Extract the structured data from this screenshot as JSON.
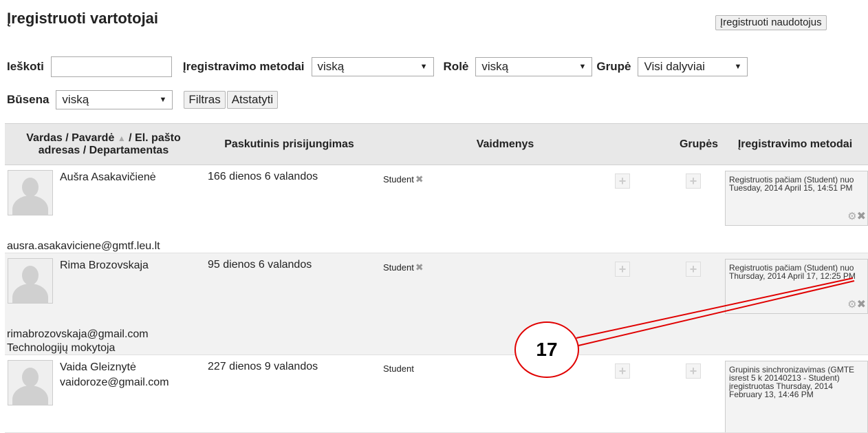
{
  "header": {
    "title": "Įregistruoti vartotojai",
    "enrol_button": "Įregistruoti naudotojus"
  },
  "filters": {
    "search_label": "Ieškoti",
    "search_value": "",
    "method_label": "Įregistravimo metodai",
    "method_value": "viską",
    "role_label": "Rolė",
    "role_value": "viską",
    "group_label": "Grupė",
    "group_value": "Visi dalyviai",
    "status_label": "Būsena",
    "status_value": "viską",
    "filter_button": "Filtras",
    "reset_button": "Atstatyti"
  },
  "table": {
    "headers": {
      "name": "Vardas / Pavardė",
      "name_rest": "/ El. pašto adresas / Departamentas",
      "last_access": "Paskutinis prisijungimas",
      "roles": "Vaidmenys",
      "groups": "Grupės",
      "methods": "Įregistravimo metodai"
    },
    "rows": [
      {
        "name": "Aušra Asakavičienė",
        "email": "ausra.asakaviciene@gmtf.leu.lt",
        "department": "",
        "last_access": "166 dienos 6 valandos",
        "role": "Student",
        "method": "Registruotis pačiam (Student) nuo Tuesday, 2014 April 15, 14:51 PM"
      },
      {
        "name": "Rima Brozovskaja",
        "email": "rimabrozovskaja@gmail.com",
        "department": "Technologijų mokytoja",
        "last_access": "95 dienos 6 valandos",
        "role": "Student",
        "method": "Registruotis pačiam (Student) nuo Thursday, 2014 April 17, 12:25 PM"
      },
      {
        "name": "Vaida Gleiznytė",
        "email": "vaidoroze@gmail.com",
        "department": "",
        "last_access": "227 dienos 9 valandos",
        "role": "Student",
        "method": "Grupinis sinchronizavimas (GMTE isrest 5 k 20140213 - Student) įregistruotas Thursday, 2014 February 13, 14:46 PM"
      }
    ]
  },
  "annotation": {
    "label": "17",
    "color": "#e00000"
  },
  "icons": {
    "remove": "close-icon",
    "edit": "gear-icon",
    "assign": "plus-icon",
    "sort": "sort-up-icon"
  }
}
